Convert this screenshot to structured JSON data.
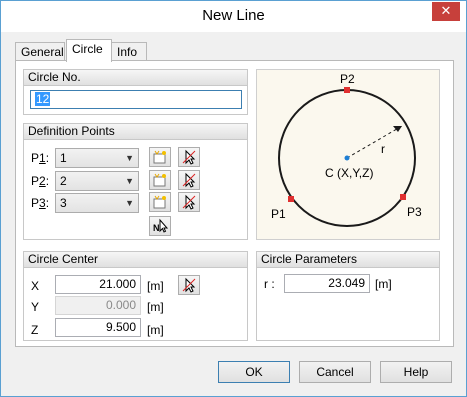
{
  "window": {
    "title": "New Line",
    "close_glyph": "✕"
  },
  "tabs": [
    {
      "label": "General",
      "active": false
    },
    {
      "label": "Circle",
      "active": true
    },
    {
      "label": "Info",
      "active": false
    }
  ],
  "circle_no": {
    "title": "Circle No.",
    "value": "12"
  },
  "definition_points": {
    "title": "Definition Points",
    "rows": [
      {
        "label_prefix": "P",
        "label_underlined": "1",
        "label_suffix": ":",
        "value": "1"
      },
      {
        "label_prefix": "P",
        "label_underlined": "2",
        "label_suffix": ":",
        "value": "2"
      },
      {
        "label_prefix": "P",
        "label_underlined": "3",
        "label_suffix": ":",
        "value": "3"
      }
    ]
  },
  "diagram": {
    "labels": {
      "p1": "P1",
      "p2": "P2",
      "p3": "P3",
      "r": "r",
      "center": "C (X,Y,Z)"
    },
    "colors": {
      "circle": "#1a1a1a",
      "point": "#e03030",
      "center": "#1e7fd4",
      "background": "#fbf8ee"
    }
  },
  "circle_center": {
    "title": "Circle Center",
    "rows": [
      {
        "label": "X",
        "value": "21.000",
        "unit": "[m]",
        "disabled": false
      },
      {
        "label": "Y",
        "value": "0.000",
        "unit": "[m]",
        "disabled": true
      },
      {
        "label": "Z",
        "value": "9.500",
        "unit": "[m]",
        "disabled": false
      }
    ]
  },
  "circle_parameters": {
    "title": "Circle Parameters",
    "radius": {
      "label": "r :",
      "value": "23.049",
      "unit": "[m]"
    }
  },
  "buttons": {
    "ok": "OK",
    "cancel": "Cancel",
    "help": "Help"
  }
}
